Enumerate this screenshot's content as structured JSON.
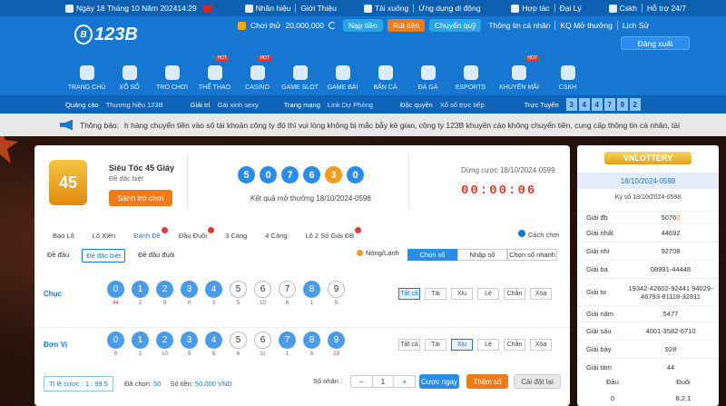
{
  "topbar": {
    "date": "Ngày 18 Tháng 10 Năm 202414:29",
    "brand": "Nhãn hiệu",
    "intro": "Giới Thiệu",
    "download": "Tải xuống",
    "app": "Ứng dụng di động",
    "partner": "Hợp tác",
    "agent": "Đại Lý",
    "support_brand": "Cskh",
    "support": "Hỗ trợ 24/7"
  },
  "header": {
    "logo": "123B",
    "trial_label": "Chơi thử",
    "balance": "20,000,000",
    "deposit": "Nạp tiền",
    "withdraw": "Rút tiền",
    "transfer": "Chuyển quỹ",
    "profile": "Thông tin cá nhân",
    "kq": "KQ Mở thưởng",
    "history": "Lịch Sử",
    "logout": "Đăng xuất"
  },
  "nav": [
    {
      "label": "TRANG CHỦ",
      "hot": false
    },
    {
      "label": "XỔ SỐ",
      "hot": false
    },
    {
      "label": "TRÒ CHƠI",
      "hot": false
    },
    {
      "label": "THỂ THAO",
      "hot": true
    },
    {
      "label": "CASINO",
      "hot": true
    },
    {
      "label": "GAME SLOT",
      "hot": false
    },
    {
      "label": "GAME BÀI",
      "hot": false
    },
    {
      "label": "BẮN CÁ",
      "hot": false
    },
    {
      "label": "ĐÁ GÀ",
      "hot": false
    },
    {
      "label": "ESPORTS",
      "hot": false
    },
    {
      "label": "KHUYẾN MÃI",
      "hot": true
    },
    {
      "label": "CSKH",
      "hot": false
    }
  ],
  "hot_label": "HOT",
  "subnav": {
    "ads": "Quảng cáo",
    "brand": "Thương hiệu 123B",
    "ent": "Giải trí",
    "ent_v": "Gái xinh sexy",
    "main": "Trang mạng",
    "main_v": "Link Dự Phòng",
    "excl": "Độc quyền",
    "excl_v": "Xổ số trực tiếp",
    "online": "Trực Tuyến",
    "digits": [
      "3",
      "4",
      "4",
      "7",
      "9",
      "2"
    ]
  },
  "notice": {
    "label": "Thông báo:",
    "text": "h hàng chuyển tiền vào số tài khoản công ty đó thì vui lòng không bị mắc bẫy kẻ gian, công ty 123B khuyến cáo không chuyển tiền, cung cấp thông tin cá nhân, tài"
  },
  "game": {
    "icon_text": "45",
    "name": "Siêu Tốc 45 Giây",
    "type": "Đề đặc biệt",
    "play": "Sảnh trò chơi"
  },
  "result": {
    "balls": [
      "5",
      "0",
      "7",
      "6",
      "3",
      "0"
    ],
    "text": "Kết quả mở thưởng 18/10/2024-0598"
  },
  "stop": {
    "label": "Dừng cược 18/10/2024-0599",
    "timer": [
      "0",
      "0",
      ":",
      "0",
      "0",
      ":",
      "0",
      "6"
    ]
  },
  "tabs": [
    {
      "label": "Bao Lô",
      "act": false,
      "dot": false
    },
    {
      "label": "Lô Xiên",
      "act": false,
      "dot": false
    },
    {
      "label": "Đánh Đề",
      "act": true,
      "dot": true
    },
    {
      "label": "Đầu Đuôi",
      "act": false,
      "dot": true
    },
    {
      "label": "3 Càng",
      "act": false,
      "dot": false
    },
    {
      "label": "4 Càng",
      "act": false,
      "dot": false
    },
    {
      "label": "Lô 2 Số Giải ĐB",
      "act": false,
      "dot": true
    }
  ],
  "howto": "Cách chơi",
  "subtabs": [
    {
      "label": "Đề đầu",
      "act": false
    },
    {
      "label": "Đề đặc biệt",
      "act": true
    },
    {
      "label": "Đề đầu đuôi",
      "act": false
    }
  ],
  "mode": {
    "hot": "Nóng/Lạnh",
    "options": [
      "Chọn số",
      "Nhập số",
      "Chọn số nhanh"
    ],
    "active": 0
  },
  "rows": [
    {
      "label": "Chục",
      "nums": [
        "0",
        "1",
        "2",
        "3",
        "4",
        "5",
        "6",
        "7",
        "8",
        "9"
      ],
      "stats": [
        "44",
        "2",
        "9",
        "0",
        "3",
        "5",
        "10",
        "6",
        "1",
        "5"
      ],
      "red": [
        0
      ],
      "selected": [
        0,
        1,
        2,
        3,
        4,
        8
      ]
    },
    {
      "label": "Đơn Vị",
      "nums": [
        "0",
        "1",
        "2",
        "3",
        "4",
        "5",
        "6",
        "7",
        "8",
        "9"
      ],
      "stats": [
        "0",
        "2",
        "10",
        "9",
        "5",
        "6",
        "11",
        "1",
        "5",
        "23"
      ],
      "red": [
        0,
        9
      ],
      "selected": [
        0,
        1,
        2,
        3,
        4,
        7,
        8,
        9
      ]
    }
  ],
  "quick": [
    "Tất cả",
    "Tài",
    "Xỉu",
    "Lẻ",
    "Chẵn",
    "Xóa"
  ],
  "quick_active": [
    0,
    2
  ],
  "bottom": {
    "ratio": "Tỉ lệ cược : 1 : 99.5",
    "chosen_label": "Đã chọn:",
    "chosen": "50",
    "money_label": "Số tiền:",
    "money": "50,000 VND",
    "multi": "Số nhân :",
    "mult_val": "1",
    "minus": "−",
    "plus": "+",
    "bet": "Cược ngay",
    "add": "Thêm số",
    "reset": "Cài đặt lại"
  },
  "side": {
    "logo": "VNLOTTERY",
    "date": "18/10/2024-0598",
    "ky": "Kỳ số 18/10/2024-0598",
    "prizes": [
      {
        "k": "Giải đb",
        "v": "50763",
        "hl": "0"
      },
      {
        "k": "Giải nhất",
        "v": "44692"
      },
      {
        "k": "Giải nhì",
        "v": "92708"
      },
      {
        "k": "Giải ba",
        "v": "08991-44448"
      },
      {
        "k": "Giải tư",
        "v": "19342-42602-92441 94029-46793-81118-32811"
      },
      {
        "k": "Giải năm",
        "v": "5477"
      },
      {
        "k": "Giải sáu",
        "v": "4001-3582-6710"
      },
      {
        "k": "Giải bảy",
        "v": "928"
      },
      {
        "k": "Giải tám",
        "v": "44"
      }
    ],
    "head": "Đầu",
    "tail": "Đuôi",
    "first_head": "0",
    "first_tail": "8,2,1"
  },
  "colors": {
    "primary": "#1677d2",
    "orange": "#f07b1a",
    "red": "#e53935"
  }
}
